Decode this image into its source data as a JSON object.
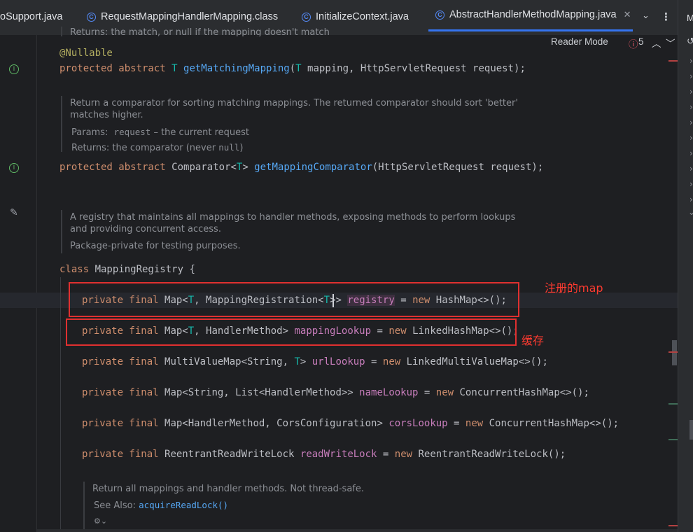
{
  "tabs": [
    {
      "label": "oSupport.java",
      "icon": "",
      "active": false
    },
    {
      "label": "RequestMappingHandlerMapping.class",
      "icon": "C",
      "active": false
    },
    {
      "label": "InitializeContext.java",
      "icon": "C",
      "active": false
    },
    {
      "label": "AbstractHandlerMethodMapping.java",
      "icon": "C",
      "active": true
    }
  ],
  "editor_hints": {
    "reader_mode": "Reader Mode",
    "problems_count": "5"
  },
  "doc_top_fragment": "Returns: the match, or null if the mapping doesn't match",
  "code": {
    "annotation_nullable": "@Nullable",
    "line_get_matching_mapping": {
      "kw": "protected abstract ",
      "tp": "T ",
      "fn": "getMatchingMapping",
      "rest_a": "(",
      "tp2": "T",
      "rest_b": " mapping, HttpServletRequest request);"
    },
    "line_get_mapping_comparator": {
      "kw": "protected abstract ",
      "type": "Comparator<",
      "tp": "T",
      "type_end": "> ",
      "fn": "getMappingComparator",
      "rest": "(HttpServletRequest request);"
    },
    "class_decl": {
      "kw": "class ",
      "name": "MappingRegistry {"
    },
    "fields": [
      {
        "kw": "private final ",
        "type_a": "Map<",
        "tp": "T",
        "type_b": ", MappingRegistration<",
        "tp2": "T",
        "type_c": ">> ",
        "name": "registry",
        "eq": " = ",
        "new": "new ",
        "ctor": "HashMap<>();"
      },
      {
        "kw": "private final ",
        "type_a": "Map<",
        "tp": "T",
        "type_b": ", HandlerMethod> ",
        "tp2": "",
        "type_c": "",
        "name": "mappingLookup",
        "eq": " = ",
        "new": "new ",
        "ctor": "LinkedHashMap<>();"
      },
      {
        "kw": "private final ",
        "type_a": "MultiValueMap<String, ",
        "tp": "T",
        "type_b": "> ",
        "tp2": "",
        "type_c": "",
        "name": "urlLookup",
        "eq": " = ",
        "new": "new ",
        "ctor": "LinkedMultiValueMap<>();"
      },
      {
        "kw": "private final ",
        "type_a": "Map<String, List<HandlerMethod>> ",
        "tp": "",
        "type_b": "",
        "tp2": "",
        "type_c": "",
        "name": "nameLookup",
        "eq": " = ",
        "new": "new ",
        "ctor": "ConcurrentHashMap<>();"
      },
      {
        "kw": "private final ",
        "type_a": "Map<HandlerMethod, CorsConfiguration> ",
        "tp": "",
        "type_b": "",
        "tp2": "",
        "type_c": "",
        "name": "corsLookup",
        "eq": " = ",
        "new": "new ",
        "ctor": "ConcurrentHashMap<>();"
      },
      {
        "kw": "private final ",
        "type_a": "ReentrantReadWriteLock ",
        "tp": "",
        "type_b": "",
        "tp2": "",
        "type_c": "",
        "name": "readWriteLock",
        "eq": " = ",
        "new": "new ",
        "ctor": "ReentrantReadWriteLock();"
      }
    ]
  },
  "docs": {
    "comparator": {
      "line1": "Return a comparator for sorting matching mappings. The returned comparator should sort 'better'",
      "line2": "matches higher.",
      "params_label": "Params:",
      "params_name": "request",
      "params_desc": " – the current request",
      "returns_label": "Returns:",
      "returns_desc": " the comparator (never ",
      "returns_null": "null",
      "returns_end": ")"
    },
    "registry": {
      "line1": "A registry that maintains all mappings to handler methods, exposing methods to perform lookups",
      "line2": "and providing concurrent access.",
      "line3": "Package-private for testing purposes."
    },
    "get_mappings": {
      "line1": "Return all mappings and handler methods. Not thread-safe.",
      "see_label": "See Also: ",
      "see_link": "acquireReadLock()"
    }
  },
  "annotations": {
    "registry_note": "注册的map",
    "cache_note": "缓存"
  },
  "colors": {
    "background": "#1e1f22",
    "keyword": "#cf8e6d",
    "method": "#56a8f5",
    "type_param": "#16baac",
    "field": "#c77dbb",
    "annotation": "#b3ae60",
    "highlight_box": "#e03030"
  }
}
